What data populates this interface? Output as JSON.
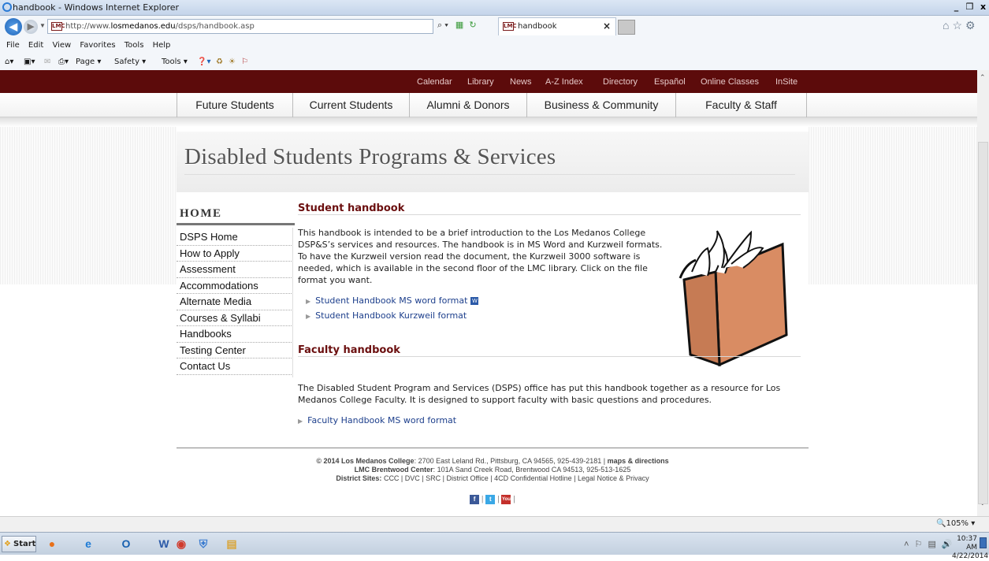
{
  "window": {
    "title": "handbook - Windows Internet Explorer",
    "controls": [
      "_",
      "❒",
      "x"
    ]
  },
  "address_bar": {
    "url_prefix": "http://www.",
    "url_domain": "losmedanos.edu",
    "url_path": "/dsps/handbook.asp",
    "search_glyph": "⌕ ▾",
    "tab_label": "handbook",
    "tab_close": "×",
    "site_icon": "LMC"
  },
  "menu_bar": [
    "File",
    "Edit",
    "View",
    "Favorites",
    "Tools",
    "Help"
  ],
  "command_bar": {
    "page": "Page ▾",
    "safety": "Safety ▾",
    "tools": "Tools ▾"
  },
  "utility_nav": [
    "Calendar",
    "Library",
    "News",
    "A-Z Index",
    "Directory",
    "Español",
    "Online Classes",
    "InSite"
  ],
  "main_nav": [
    "Future Students",
    "Current Students",
    "Alumni & Donors",
    "Business & Community",
    "Faculty & Staff"
  ],
  "page_title": "Disabled Students Programs & Services",
  "sidebar": {
    "heading": "HOME",
    "items": [
      "DSPS Home",
      "How to Apply",
      "Assessment",
      "Accommodations",
      "Alternate Media",
      "Courses & Syllabi",
      "Handbooks",
      "Testing Center",
      "Contact Us"
    ]
  },
  "student_section": {
    "heading": "Student handbook",
    "body": "This handbook is intended to be a brief introduction to the Los Medanos College DSP&S’s services and resources. The handbook is in MS Word and Kurzweil formats. To have the Kurzweil version read the document, the Kurzweil 3000 software is needed, which is available in the second floor of the LMC library. Click on the file format you want.",
    "links": [
      "Student Handbook MS word format",
      "Student Handbook Kurzweil format"
    ],
    "word_icon": "W"
  },
  "faculty_section": {
    "heading": "Faculty handbook",
    "body": "The Disabled Student Program and Services (DSPS) office has put this handbook together as a resource for Los Medanos College Faculty. It is designed to support faculty with basic questions and procedures.",
    "links": [
      "Faculty Handbook MS word format"
    ]
  },
  "footer": {
    "line1_bold": "© 2014 Los Medanos College",
    "line1_rest": ": 2700 East Leland Rd., Pittsburg, CA 94565, 925-439-2181 | ",
    "line1_link": "maps & directions",
    "line2_bold": "LMC Brentwood Center",
    "line2_rest": ": 101A Sand Creek Road, Brentwood CA 94513, 925-513-1625",
    "line3_bold": "District Sites:",
    "line3_rest": " CCC | DVC | SRC | District Office | 4CD Confidential Hotline | Legal Notice & Privacy",
    "social": {
      "facebook": "f",
      "twitter": "t",
      "youtube": "You",
      "sep": "|"
    }
  },
  "status_bar": {
    "zoom": "105%"
  },
  "taskbar": {
    "start": "Start",
    "time": "10:37 AM",
    "date": "4/22/2014",
    "apps": [
      {
        "name": "firefox",
        "glyph": "●",
        "color": "#e8701a"
      },
      {
        "name": "internet-explorer",
        "glyph": "e",
        "color": "#1e7bd6"
      },
      {
        "name": "outlook",
        "glyph": "O",
        "color": "#1860b0"
      },
      {
        "name": "word",
        "glyph": "W",
        "color": "#2b5aa8"
      },
      {
        "name": "chrome",
        "glyph": "◉",
        "color": "#d03a2c"
      },
      {
        "name": "security",
        "glyph": "⛨",
        "color": "#3a7bd0"
      },
      {
        "name": "file-explorer",
        "glyph": "▤",
        "color": "#d9a63c"
      }
    ]
  }
}
